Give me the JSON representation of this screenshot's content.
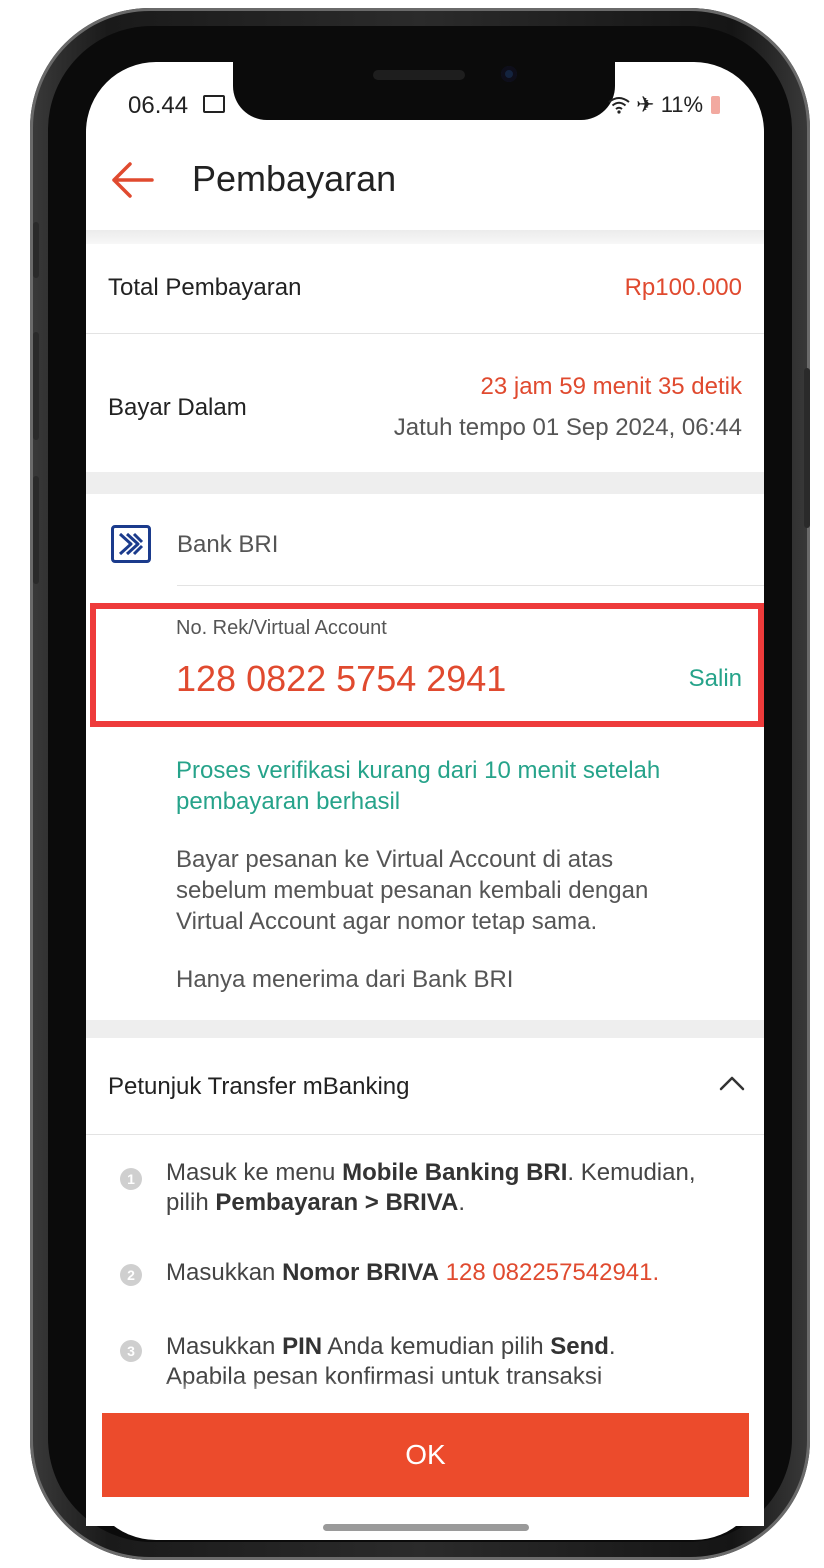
{
  "status_bar": {
    "time": "06.44",
    "battery": "11%"
  },
  "header": {
    "title": "Pembayaran"
  },
  "total": {
    "label": "Total Pembayaran",
    "amount": "Rp100.000"
  },
  "deadline": {
    "label": "Bayar Dalam",
    "countdown": "23 jam 59 menit 35 detik",
    "due": "Jatuh tempo 01 Sep 2024, 06:44"
  },
  "bank": {
    "name": "Bank BRI",
    "va_label": "No. Rek/Virtual Account",
    "va_number": "128  0822 5754 2941",
    "copy_label": "Salin",
    "verification_line1": "Proses verifikasi kurang dari 10 menit setelah",
    "verification_line2": "pembayaran berhasil",
    "note_line1": "Bayar pesanan ke Virtual Account di atas",
    "note_line2": "sebelum membuat pesanan kembali dengan",
    "note_line3": "Virtual Account agar nomor tetap sama.",
    "accept_only": "Hanya menerima dari Bank BRI"
  },
  "instructions": {
    "title": "Petunjuk Transfer mBanking",
    "steps": [
      {
        "num": "1",
        "l1_a": "Masuk ke menu ",
        "l1_b": "Mobile Banking BRI",
        "l1_c": ". Kemudian,",
        "l2_a": "pilih ",
        "l2_b": "Pembayaran > BRIVA",
        "l2_c": "."
      },
      {
        "num": "2",
        "l1_a": "Masukkan ",
        "l1_b": "Nomor BRIVA",
        "l1_c": " 128 082257542941."
      },
      {
        "num": "3",
        "l1_a": "Masukkan ",
        "l1_b": "PIN",
        "l1_c": " Anda kemudian pilih ",
        "l1_d": "Send",
        "l1_e": ".",
        "l2_a": "Apabila pesan konfirmasi untuk transaksi"
      }
    ]
  },
  "ok_button": {
    "label": "OK"
  }
}
